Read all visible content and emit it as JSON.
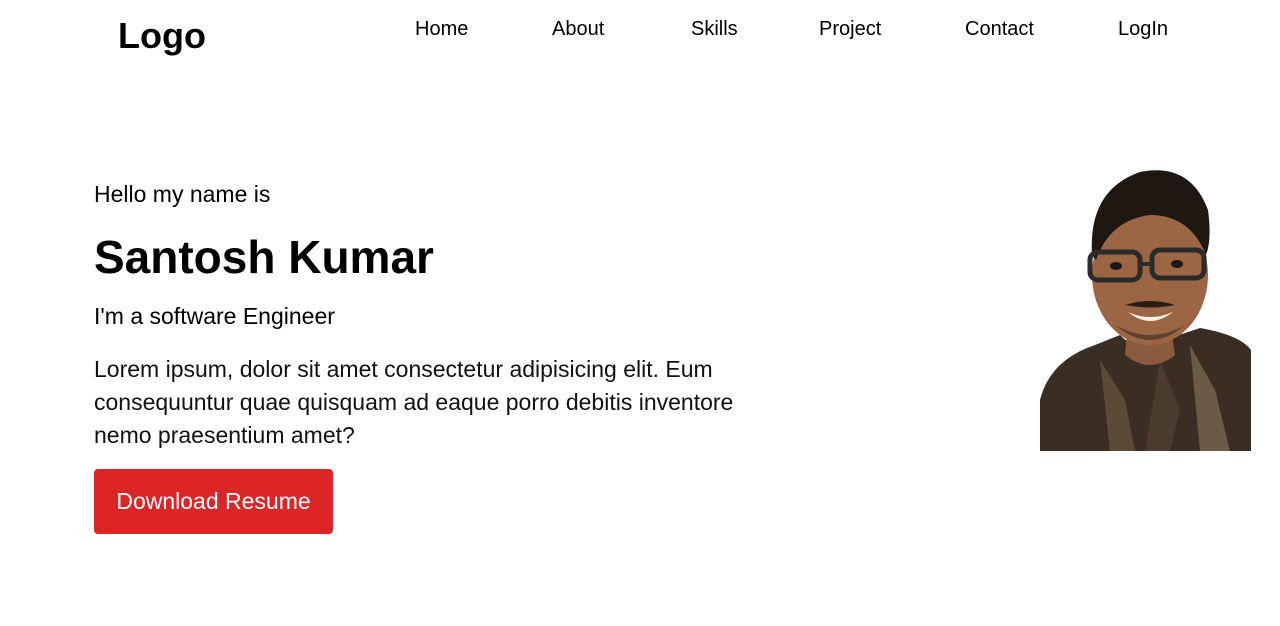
{
  "header": {
    "logo": "Logo",
    "nav": [
      {
        "label": "Home"
      },
      {
        "label": "About"
      },
      {
        "label": "Skills"
      },
      {
        "label": "Project"
      },
      {
        "label": "Contact"
      },
      {
        "label": "LogIn"
      }
    ]
  },
  "hero": {
    "greeting": "Hello my name is",
    "name": "Santosh Kumar",
    "role": "I'm a software Engineer",
    "description": "Lorem ipsum, dolor sit amet consectetur adipisicing elit. Eum consequuntur quae quisquam ad eaque porro debitis inventore nemo praesentium amet?",
    "button_label": "Download Resume",
    "photo_icon": "profile-photo"
  },
  "colors": {
    "button": "#dc2626",
    "text": "#000000",
    "background": "#ffffff"
  }
}
